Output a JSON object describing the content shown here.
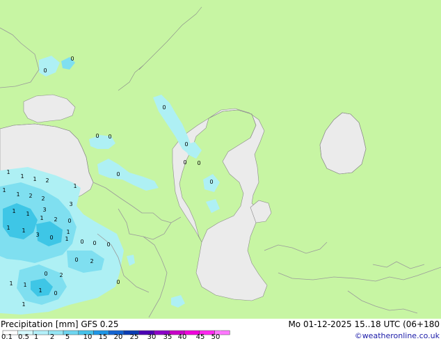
{
  "map": {
    "colors": {
      "land": "#c7f5a3",
      "water": "#ebebeb",
      "precip_light": "#aef0f4",
      "precip_mid": "#7fdff0",
      "precip_heavy": "#3ec6e6",
      "border": "#9a9a9a"
    },
    "precip_values": [
      "0",
      "0",
      "0",
      "0",
      "0",
      "0",
      "0",
      "0",
      "0",
      "0",
      "1",
      "1",
      "1",
      "1",
      "1",
      "1",
      "2",
      "2",
      "2",
      "3",
      "3",
      "1",
      "1",
      "1",
      "2",
      "0",
      "1",
      "1",
      "1",
      "3",
      "0",
      "1",
      "0",
      "0",
      "0",
      "2",
      "0",
      "0",
      "1",
      "1",
      "1",
      "2",
      "0",
      "1",
      "0"
    ]
  },
  "footer": {
    "title": "Precipitation [mm]  GFS 0.25",
    "timestamp": "Mo 01-12-2025 15..18 UTC (06+180",
    "credit": "©weatheronline.co.uk",
    "legend": {
      "ticks": [
        "0.1",
        "0.5",
        "1",
        "2",
        "5",
        "10",
        "15",
        "20",
        "25",
        "30",
        "35",
        "40",
        "45",
        "50"
      ],
      "colors": [
        "#ffffff",
        "#d6fafe",
        "#b4f0fa",
        "#96e6f5",
        "#6ed6f0",
        "#46c2ea",
        "#1e96e6",
        "#1464d2",
        "#0a3cb4",
        "#4b00b4",
        "#8c00c8",
        "#c800c8",
        "#f000dc",
        "#ff28f0",
        "#ff78ff"
      ]
    }
  }
}
